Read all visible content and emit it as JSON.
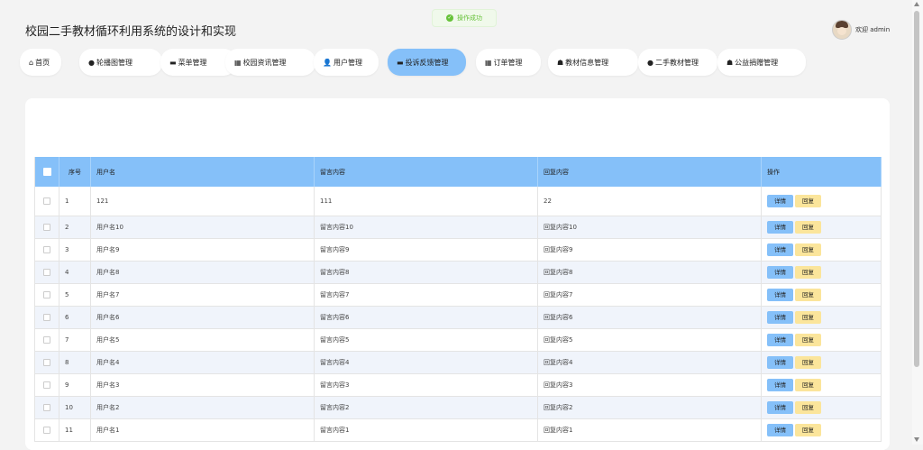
{
  "app": {
    "title": "校园二手教材循环利用系统的设计和实现"
  },
  "toast": {
    "text": "操作成功",
    "icon": "check-circle-icon",
    "color": "#67c23a"
  },
  "user": {
    "greeting": "欢迎 admin"
  },
  "colors": {
    "accent": "#85c0f9",
    "reply": "#fbe59b"
  },
  "nav": {
    "tabs": [
      {
        "label": "首页",
        "icon": "home-icon",
        "glyph": "⌂"
      },
      {
        "label": "轮播图管理",
        "icon": "carousel-icon",
        "glyph": "●"
      },
      {
        "label": "菜单管理",
        "icon": "menu-icon",
        "glyph": "▬"
      },
      {
        "label": "校园资讯管理",
        "icon": "grid-icon",
        "glyph": "▦"
      },
      {
        "label": "用户管理",
        "icon": "user-icon",
        "glyph": "👤"
      },
      {
        "label": "投诉反馈管理",
        "icon": "feedback-icon",
        "glyph": "▬",
        "active": true
      },
      {
        "label": "订单管理",
        "icon": "order-icon",
        "glyph": "▦"
      },
      {
        "label": "教材信息管理",
        "icon": "book-icon",
        "glyph": "☗"
      },
      {
        "label": "二手教材管理",
        "icon": "drop-icon",
        "glyph": "●"
      },
      {
        "label": "公益捐赠管理",
        "icon": "gift-icon",
        "glyph": "☗"
      }
    ]
  },
  "table": {
    "headers": {
      "seq": "序号",
      "username": "用户名",
      "content": "留言内容",
      "reply": "回复内容",
      "actions": "操作"
    },
    "detail_label": "详情",
    "reply_label": "回复",
    "rows": [
      {
        "seq": "1",
        "username": "121",
        "content": "111",
        "reply": "22"
      },
      {
        "seq": "2",
        "username": "用户名10",
        "content": "留言内容10",
        "reply": "回复内容10"
      },
      {
        "seq": "3",
        "username": "用户名9",
        "content": "留言内容9",
        "reply": "回复内容9"
      },
      {
        "seq": "4",
        "username": "用户名8",
        "content": "留言内容8",
        "reply": "回复内容8"
      },
      {
        "seq": "5",
        "username": "用户名7",
        "content": "留言内容7",
        "reply": "回复内容7"
      },
      {
        "seq": "6",
        "username": "用户名6",
        "content": "留言内容6",
        "reply": "回复内容6"
      },
      {
        "seq": "7",
        "username": "用户名5",
        "content": "留言内容5",
        "reply": "回复内容5"
      },
      {
        "seq": "8",
        "username": "用户名4",
        "content": "留言内容4",
        "reply": "回复内容4"
      },
      {
        "seq": "9",
        "username": "用户名3",
        "content": "留言内容3",
        "reply": "回复内容3"
      },
      {
        "seq": "10",
        "username": "用户名2",
        "content": "留言内容2",
        "reply": "回复内容2"
      },
      {
        "seq": "11",
        "username": "用户名1",
        "content": "留言内容1",
        "reply": "回复内容1"
      }
    ]
  }
}
